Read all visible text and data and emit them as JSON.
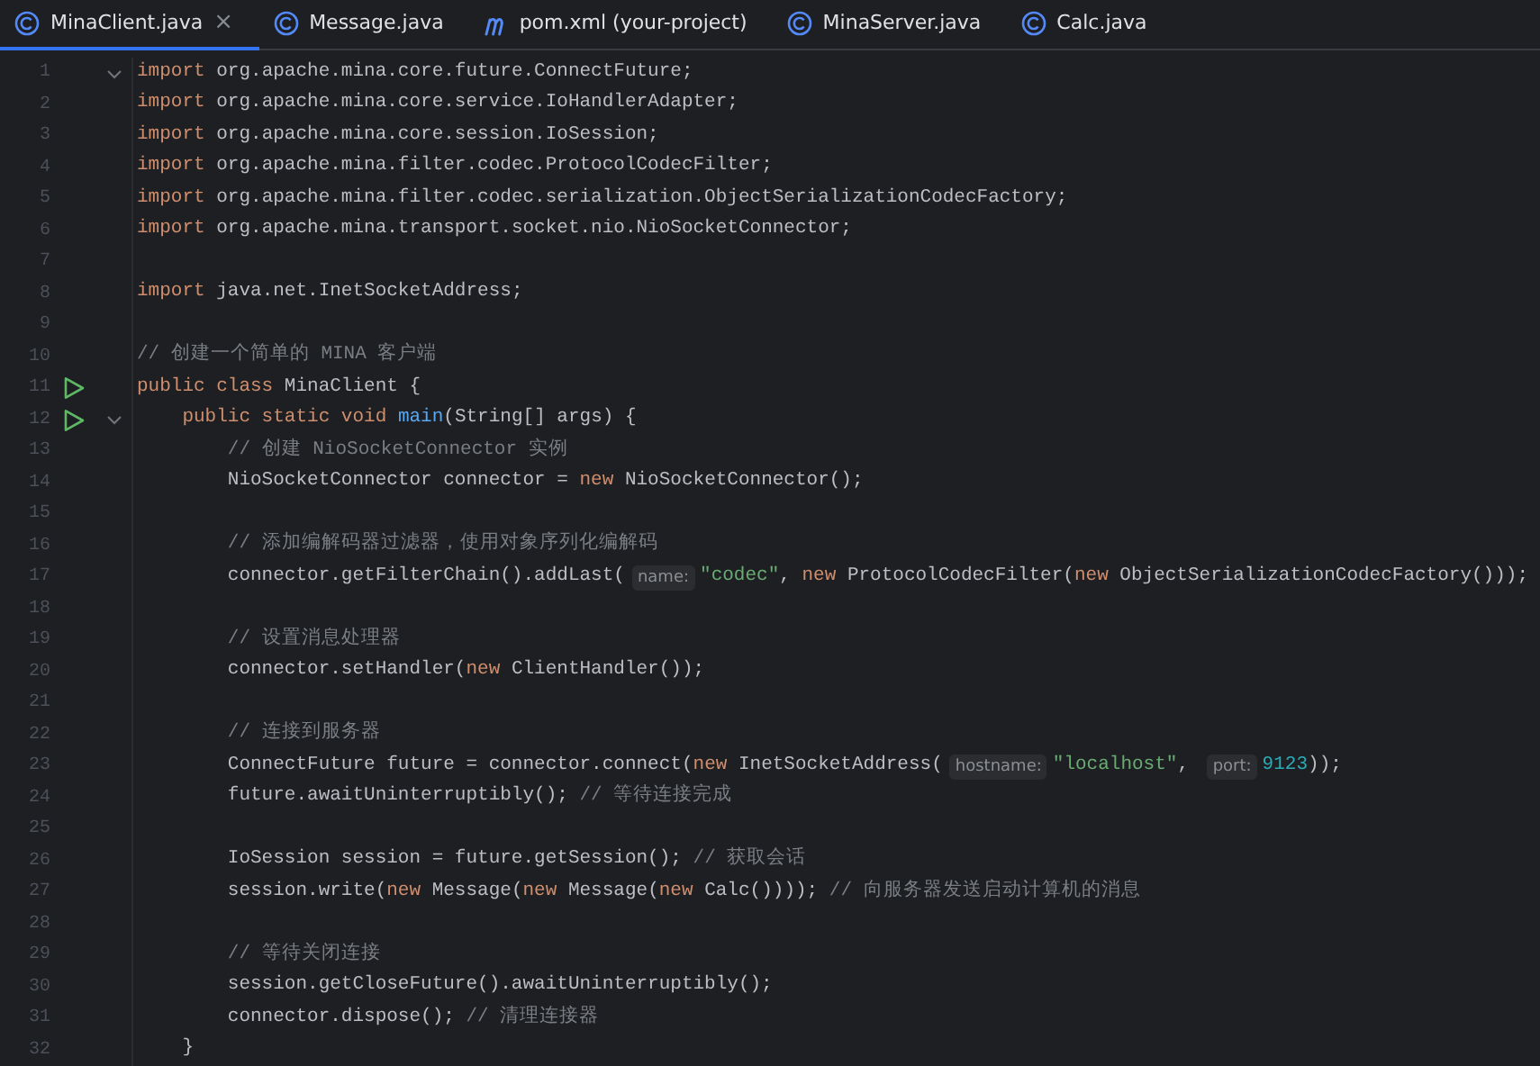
{
  "tabs": [
    {
      "label": "MinaClient.java",
      "kind": "class",
      "selected": true,
      "close": "×"
    },
    {
      "label": "Message.java",
      "kind": "class",
      "selected": false
    },
    {
      "label": "pom.xml (your-project)",
      "kind": "maven",
      "selected": false
    },
    {
      "label": "MinaServer.java",
      "kind": "class",
      "selected": false
    },
    {
      "label": "Calc.java",
      "kind": "class",
      "selected": false
    }
  ],
  "lines": [
    {
      "number": "1",
      "fold": true,
      "run": false,
      "tokens": [
        {
          "kind": "k",
          "text": "import"
        },
        {
          "kind": "p",
          "text": " org.apache.mina.core.future.ConnectFuture;"
        }
      ]
    },
    {
      "number": "2",
      "fold": false,
      "run": false,
      "tokens": [
        {
          "kind": "k",
          "text": "import"
        },
        {
          "kind": "p",
          "text": " org.apache.mina.core.service.IoHandlerAdapter;"
        }
      ]
    },
    {
      "number": "3",
      "fold": false,
      "run": false,
      "tokens": [
        {
          "kind": "k",
          "text": "import"
        },
        {
          "kind": "p",
          "text": " org.apache.mina.core.session.IoSession;"
        }
      ]
    },
    {
      "number": "4",
      "fold": false,
      "run": false,
      "tokens": [
        {
          "kind": "k",
          "text": "import"
        },
        {
          "kind": "p",
          "text": " org.apache.mina.filter.codec.ProtocolCodecFilter;"
        }
      ]
    },
    {
      "number": "5",
      "fold": false,
      "run": false,
      "tokens": [
        {
          "kind": "k",
          "text": "import"
        },
        {
          "kind": "p",
          "text": " org.apache.mina.filter.codec.serialization.ObjectSerializationCodecFactory;"
        }
      ]
    },
    {
      "number": "6",
      "fold": false,
      "run": false,
      "tokens": [
        {
          "kind": "k",
          "text": "import"
        },
        {
          "kind": "p",
          "text": " org.apache.mina.transport.socket.nio.NioSocketConnector;"
        }
      ]
    },
    {
      "number": "7",
      "fold": false,
      "run": false
    },
    {
      "number": "8",
      "fold": false,
      "run": false,
      "tokens": [
        {
          "kind": "k",
          "text": "import"
        },
        {
          "kind": "p",
          "text": " java.net.InetSocketAddress;"
        }
      ]
    },
    {
      "number": "9",
      "fold": false,
      "run": false
    },
    {
      "number": "10",
      "fold": false,
      "run": false,
      "tokens": [
        {
          "kind": "c",
          "text": "// 创建一个简单的 MINA 客户端"
        }
      ]
    },
    {
      "number": "11",
      "fold": false,
      "run": true,
      "tokens": [
        {
          "kind": "k",
          "text": "public class"
        },
        {
          "kind": "p",
          "text": " MinaClient {"
        }
      ]
    },
    {
      "number": "12",
      "fold": true,
      "run": true,
      "tokens": [
        {
          "kind": "k",
          "text": "    public static void "
        },
        {
          "kind": "f",
          "text": "main"
        },
        {
          "kind": "p",
          "text": "(String[] args) {"
        }
      ]
    },
    {
      "number": "13",
      "fold": false,
      "run": false,
      "tokens": [
        {
          "kind": "c",
          "text": "        // 创建 NioSocketConnector 实例"
        }
      ]
    },
    {
      "number": "14",
      "fold": false,
      "run": false,
      "tokens": [
        {
          "kind": "p",
          "text": "        NioSocketConnector connector = "
        },
        {
          "kind": "k",
          "text": "new"
        },
        {
          "kind": "p",
          "text": " NioSocketConnector();"
        }
      ]
    },
    {
      "number": "15",
      "fold": false,
      "run": false
    },
    {
      "number": "16",
      "fold": false,
      "run": false,
      "tokens": [
        {
          "kind": "c",
          "text": "        // 添加编解码器过滤器，使用对象序列化编解码"
        }
      ]
    },
    {
      "number": "17",
      "fold": false,
      "run": false,
      "tokens": [
        {
          "kind": "p",
          "text": "        connector.getFilterChain().addLast("
        },
        {
          "kind": "h",
          "text": "name:"
        },
        {
          "kind": "s",
          "text": "\"codec\""
        },
        {
          "kind": "p",
          "text": ", "
        },
        {
          "kind": "k",
          "text": "new"
        },
        {
          "kind": "p",
          "text": " ProtocolCodecFilter("
        },
        {
          "kind": "k",
          "text": "new"
        },
        {
          "kind": "p",
          "text": " ObjectSerializationCodecFactory()));"
        }
      ]
    },
    {
      "number": "18",
      "fold": false,
      "run": false
    },
    {
      "number": "19",
      "fold": false,
      "run": false,
      "tokens": [
        {
          "kind": "c",
          "text": "        // 设置消息处理器"
        }
      ]
    },
    {
      "number": "20",
      "fold": false,
      "run": false,
      "tokens": [
        {
          "kind": "p",
          "text": "        connector.setHandler("
        },
        {
          "kind": "k",
          "text": "new"
        },
        {
          "kind": "p",
          "text": " ClientHandler());"
        }
      ]
    },
    {
      "number": "21",
      "fold": false,
      "run": false
    },
    {
      "number": "22",
      "fold": false,
      "run": false,
      "tokens": [
        {
          "kind": "c",
          "text": "        // 连接到服务器"
        }
      ]
    },
    {
      "number": "23",
      "fold": false,
      "run": false,
      "tokens": [
        {
          "kind": "p",
          "text": "        ConnectFuture future = connector.connect("
        },
        {
          "kind": "k",
          "text": "new"
        },
        {
          "kind": "p",
          "text": " InetSocketAddress("
        },
        {
          "kind": "h",
          "text": "hostname:"
        },
        {
          "kind": "s",
          "text": "\"localhost\""
        },
        {
          "kind": "p",
          "text": ", "
        },
        {
          "kind": "h",
          "text": "port:"
        },
        {
          "kind": "n",
          "text": "9123"
        },
        {
          "kind": "p",
          "text": "));"
        }
      ]
    },
    {
      "number": "24",
      "fold": false,
      "run": false,
      "tokens": [
        {
          "kind": "p",
          "text": "        future.awaitUninterruptibly(); "
        },
        {
          "kind": "c",
          "text": "// 等待连接完成"
        }
      ]
    },
    {
      "number": "25",
      "fold": false,
      "run": false
    },
    {
      "number": "26",
      "fold": false,
      "run": false,
      "tokens": [
        {
          "kind": "p",
          "text": "        IoSession session = future.getSession(); "
        },
        {
          "kind": "c",
          "text": "// 获取会话"
        }
      ]
    },
    {
      "number": "27",
      "fold": false,
      "run": false,
      "tokens": [
        {
          "kind": "p",
          "text": "        session.write("
        },
        {
          "kind": "k",
          "text": "new"
        },
        {
          "kind": "p",
          "text": " Message("
        },
        {
          "kind": "k",
          "text": "new"
        },
        {
          "kind": "p",
          "text": " Message("
        },
        {
          "kind": "k",
          "text": "new"
        },
        {
          "kind": "p",
          "text": " Calc()))); "
        },
        {
          "kind": "c",
          "text": "// 向服务器发送启动计算机的消息"
        }
      ]
    },
    {
      "number": "28",
      "fold": false,
      "run": false
    },
    {
      "number": "29",
      "fold": false,
      "run": false,
      "tokens": [
        {
          "kind": "c",
          "text": "        // 等待关闭连接"
        }
      ]
    },
    {
      "number": "30",
      "fold": false,
      "run": false,
      "tokens": [
        {
          "kind": "p",
          "text": "        session.getCloseFuture().awaitUninterruptibly();"
        }
      ]
    },
    {
      "number": "31",
      "fold": false,
      "run": false,
      "tokens": [
        {
          "kind": "p",
          "text": "        connector.dispose(); "
        },
        {
          "kind": "c",
          "text": "// 清理连接器"
        }
      ]
    },
    {
      "number": "32",
      "fold": false,
      "run": false,
      "tokens": [
        {
          "kind": "p",
          "text": "    }"
        }
      ]
    }
  ]
}
